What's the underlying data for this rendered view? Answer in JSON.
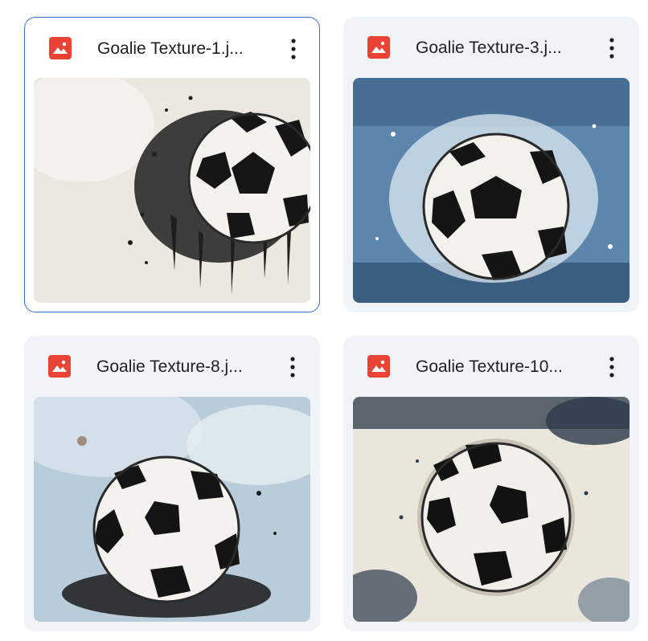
{
  "files": [
    {
      "name": "Goalie Texture-1.j...",
      "selected": true,
      "icon": "image-file-icon",
      "thumbnail": {
        "subject": "soccer ball",
        "background": "#ece8df",
        "splash": "#1e1e1e",
        "ball_panel": "#f4f2ec",
        "ball_patch": "#161616"
      }
    },
    {
      "name": "Goalie Texture-3.j...",
      "selected": false,
      "icon": "image-file-icon",
      "thumbnail": {
        "subject": "soccer ball",
        "background": "#5d86ad",
        "splash": "#dde9f2",
        "ball_panel": "#f2f1ec",
        "ball_patch": "#141414"
      }
    },
    {
      "name": "Goalie Texture-8.j...",
      "selected": false,
      "icon": "image-file-icon",
      "thumbnail": {
        "subject": "soccer ball",
        "background": "#b9ccd9",
        "splash": "#1a1a1a",
        "ball_panel": "#f3f2ee",
        "ball_patch": "#141414"
      }
    },
    {
      "name": "Goalie Texture-10...",
      "selected": false,
      "icon": "image-file-icon",
      "thumbnail": {
        "subject": "soccer ball",
        "background": "#ebe6dc",
        "splash": "#2c3a4a",
        "ball_panel": "#f1efea",
        "ball_patch": "#121212"
      }
    }
  ],
  "colors": {
    "icon_red": "#ea4335",
    "selected_border": "#3b6fd8",
    "card_bg": "#f0f4f9",
    "text": "#1f1f1f"
  },
  "more_icon": "more-vert-icon"
}
